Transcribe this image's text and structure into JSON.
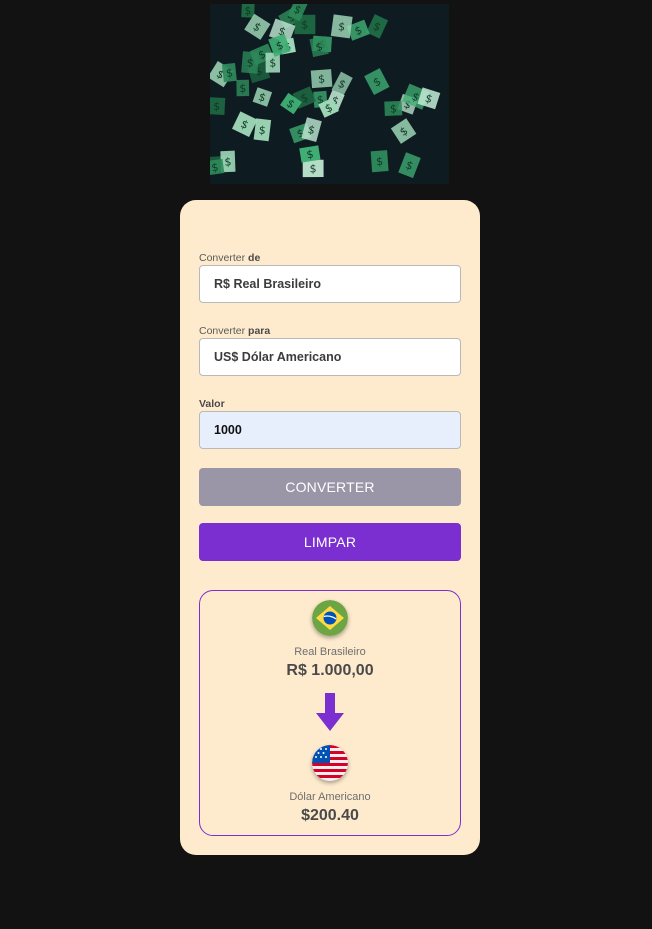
{
  "hero": {
    "image": "money-rain-image",
    "colors": {
      "bill": "#2e8a5a",
      "bill_light": "#9fd8b8"
    }
  },
  "form": {
    "from": {
      "label_prefix": "Converter",
      "label_emph": "de",
      "value": "R$ Real Brasileiro"
    },
    "to": {
      "label_prefix": "Converter",
      "label_emph": "para",
      "value": "US$ Dólar Americano"
    },
    "amount": {
      "label": "Valor",
      "value": "1000"
    },
    "convert_label": "CONVERTER",
    "clear_label": "LIMPAR"
  },
  "result": {
    "source": {
      "flag": "brazil-flag-icon",
      "name": "Real Brasileiro",
      "value": "R$ 1.000,00"
    },
    "target": {
      "flag": "usa-flag-icon",
      "name": "Dólar Americano",
      "value": "$200.40"
    },
    "arrow": "arrow-down-icon"
  },
  "colors": {
    "page_bg": "#121212",
    "card_bg": "#feebcd",
    "accent": "#7b2fd0",
    "disabled_button": "#9a96a8",
    "input_active": "#e8effc"
  }
}
